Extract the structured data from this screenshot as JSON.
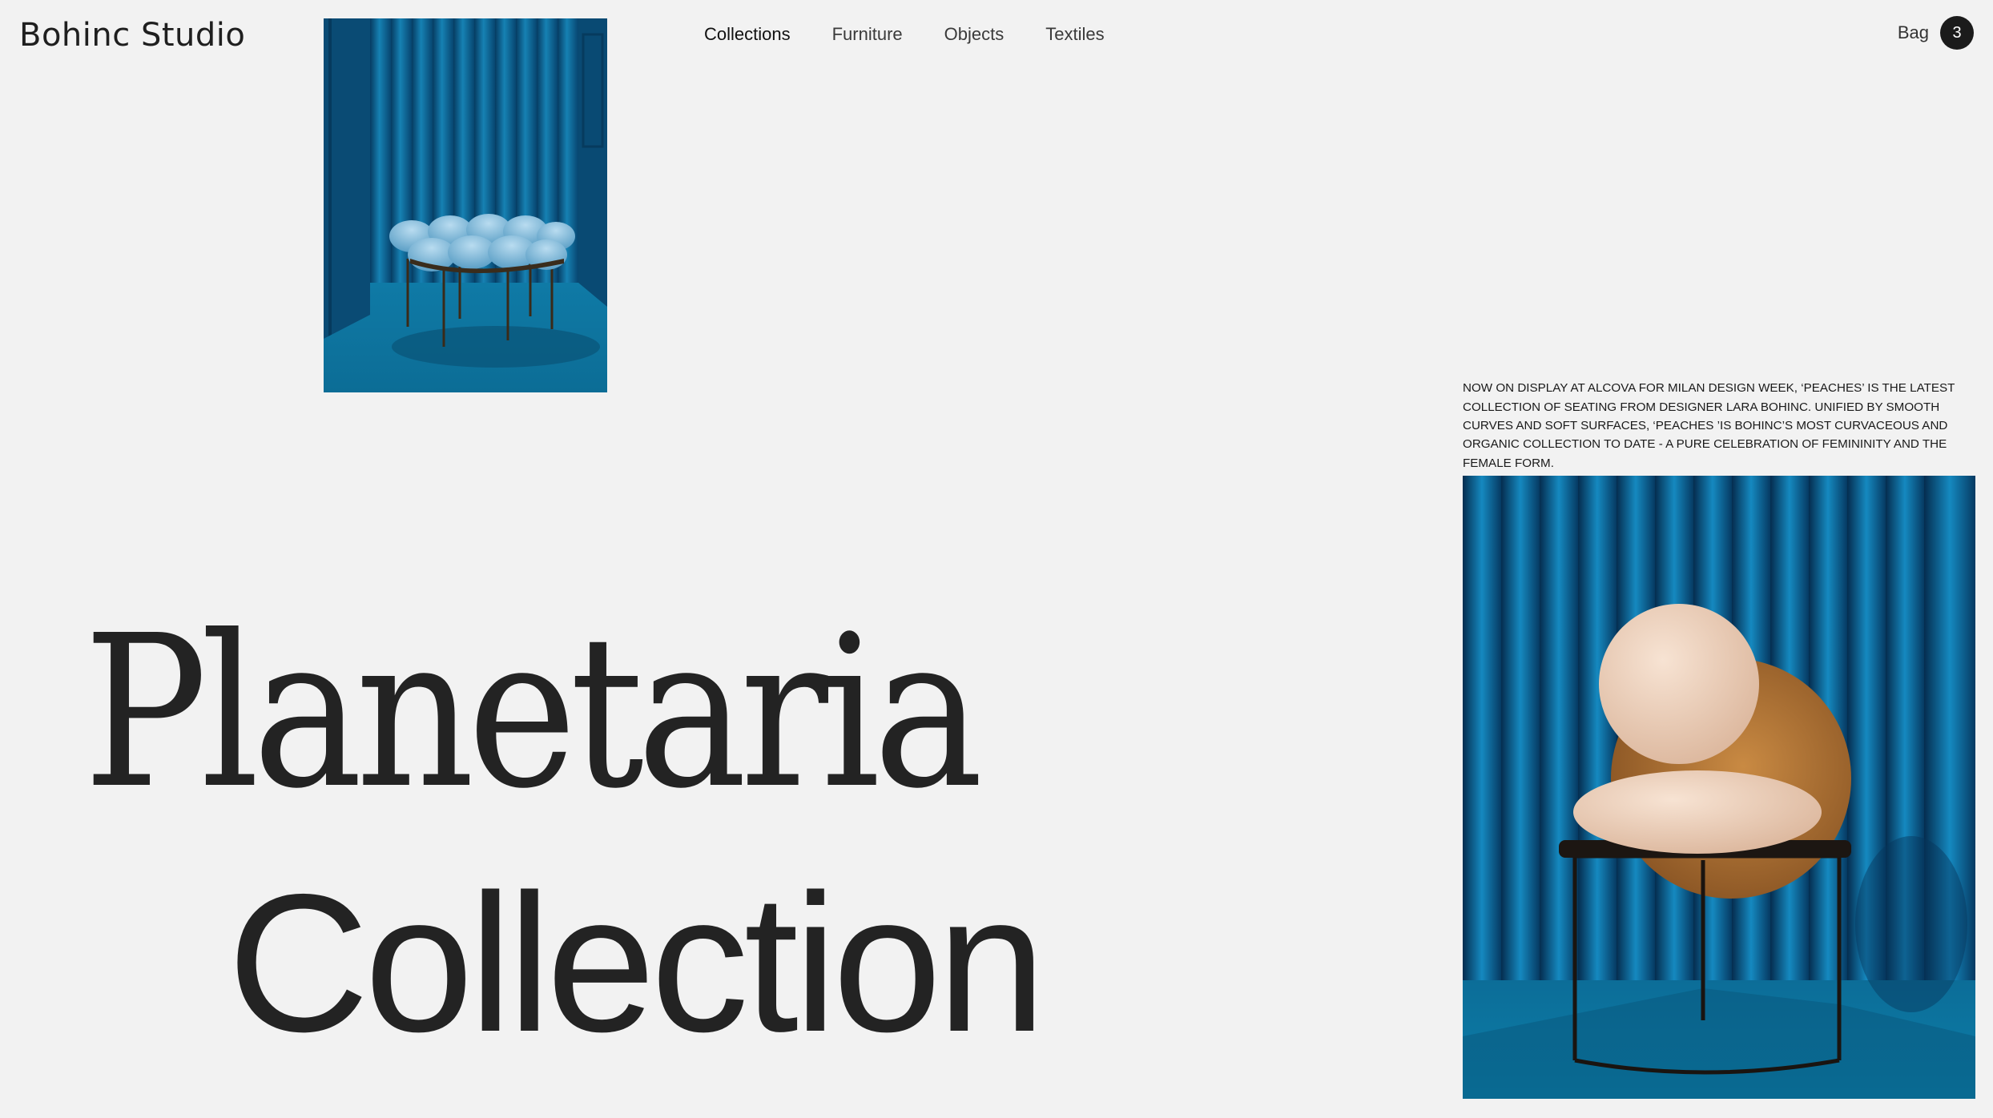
{
  "brand": {
    "logo": "Bohinc Studio"
  },
  "nav": {
    "items": [
      {
        "label": "Collections",
        "active": true
      },
      {
        "label": "Furniture",
        "active": false
      },
      {
        "label": "Objects",
        "active": false
      },
      {
        "label": "Textiles",
        "active": false
      }
    ]
  },
  "bag": {
    "label": "Bag",
    "count": "3"
  },
  "hero": {
    "title_line1": "Planetaria",
    "title_line2": "Collection"
  },
  "feature": {
    "description": "Now on display at Alcova for Milan Design Week, ‘Peaches’ is the latest collection of seating from designer Lara Bohinc. Unified by smooth curves and soft surfaces, ‘Peaches ’is Bohinc’s most curvaceous and organic collection to date - a pure celebration of femininity and the female form."
  },
  "colors": {
    "background": "#f2f2f2",
    "text": "#232323",
    "accent_blue": "#0a6f9c",
    "badge": "#1b1b1b"
  }
}
